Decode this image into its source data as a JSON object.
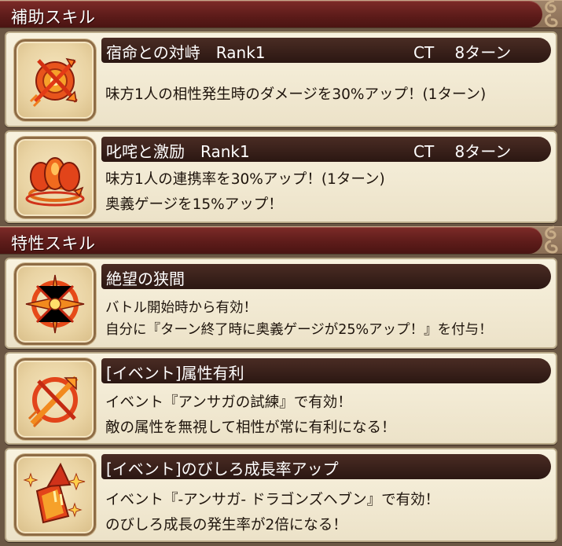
{
  "sections": [
    {
      "title": "補助スキル"
    },
    {
      "title": "特性スキル"
    }
  ],
  "skills": [
    {
      "name": "宿命との対峙　Rank1",
      "ct": "CT　 8ターン",
      "icon": "crossed-arrows-shield-icon",
      "lines": [
        "味方1人の相性発生時のダメージを30%アップ！(1ターン)"
      ]
    },
    {
      "name": "叱咤と激励　Rank1",
      "ct": "CT　 8ターン",
      "icon": "flame-orbs-icon",
      "lines": [
        "味方1人の連携率を30%アップ！(1ターン)",
        "奥義ゲージを15%アップ！"
      ]
    },
    {
      "name": "絶望の狭間",
      "ct": "",
      "icon": "star-ring-icon",
      "lines": [
        "バトル開始時から有効！",
        "自分に『ターン終了時に奥義ゲージが25%アップ！』を付与！"
      ]
    },
    {
      "name": "[イベント]属性有利",
      "ct": "",
      "icon": "slashed-arrow-icon",
      "lines": [
        "イベント『アンサガの試練』で有効！",
        "敵の属性を無視して相性が常に有利になる！"
      ]
    },
    {
      "name": "[イベント]のびしろ成長率アップ",
      "ct": "",
      "icon": "rising-arrow-sparkle-icon",
      "lines": [
        "イベント『-アンサガ- ドラゴンズヘブン』で有効！",
        "のびしろ成長の発生率が2倍になる！"
      ]
    }
  ],
  "colors": {
    "header_red": "#5e1c1a",
    "name_bar": "#2b1712",
    "card_bg": "#f8f2df",
    "icon_orange": "#f08a1a",
    "icon_red": "#d0321a"
  }
}
